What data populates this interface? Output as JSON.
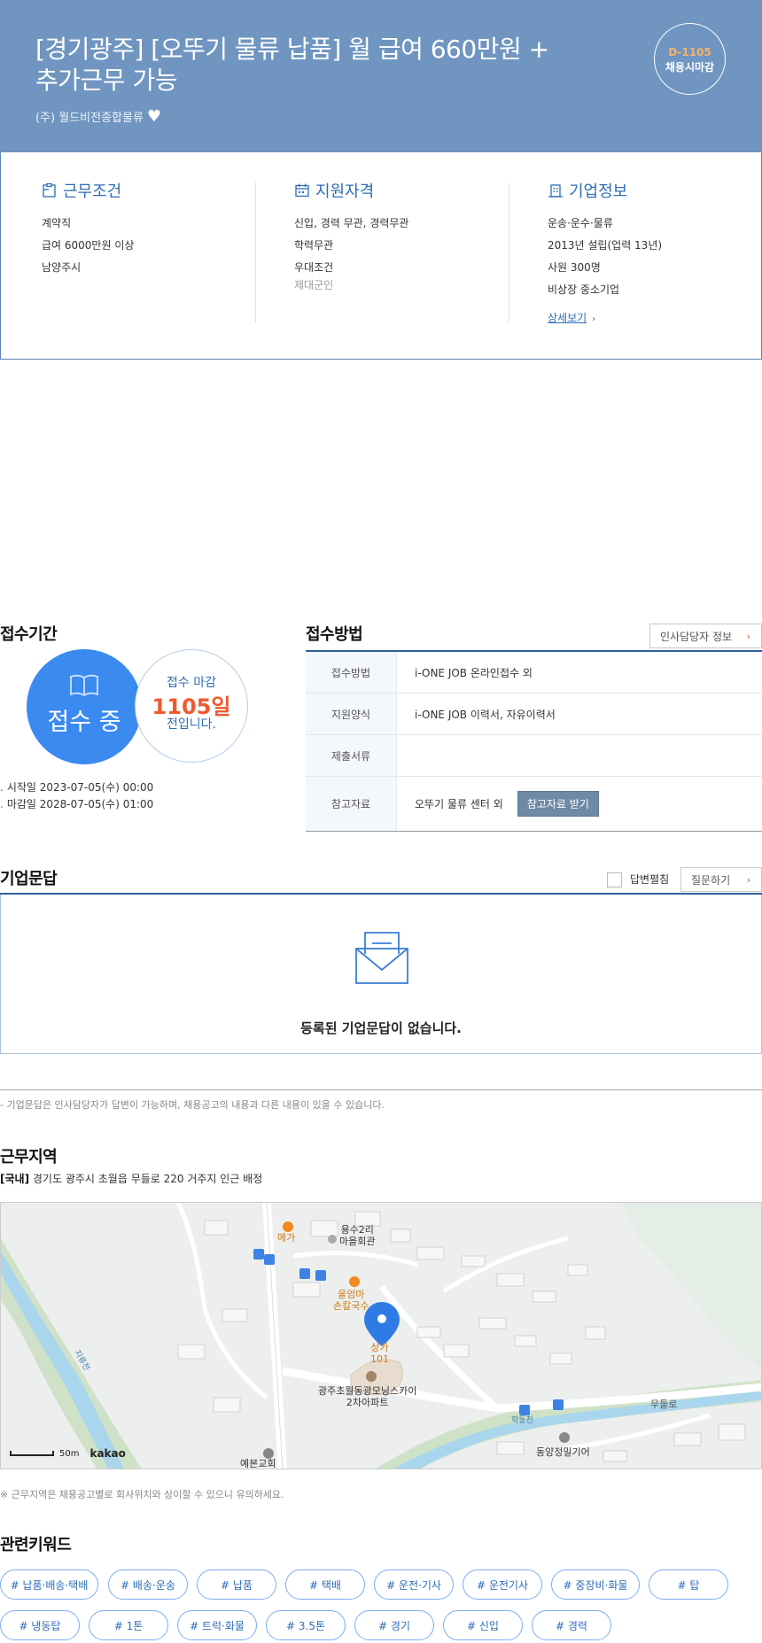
{
  "header": {
    "title_line1": "[경기광주] [오뚜기 물류 납품] 월 급여 660만원 +",
    "title_line2": "추가근무 가능",
    "company": "(주) 월드비전종합물류",
    "dday": "D-1105",
    "deadline_type": "채용시마감"
  },
  "summary": {
    "conditions": {
      "title": "근무조건",
      "items": [
        "계약직",
        "급여 6000만원 이상",
        "남양주시"
      ]
    },
    "qualifications": {
      "title": "지원자격",
      "items": [
        "신입, 경력 무관, 경력무관",
        "학력무관",
        "우대조건"
      ],
      "sub": "제대군인"
    },
    "company_info": {
      "title": "기업정보",
      "items": [
        "운송·운수·물류",
        "2013년 설립(업력 13년)",
        "사원 300명",
        "비상장 중소기업"
      ],
      "detail_link": "상세보기"
    }
  },
  "period": {
    "heading": "접수기간",
    "status": "접수 중",
    "deadline_label": "접수 마감",
    "days": "1105일",
    "days_suffix": "전입니다.",
    "start": "시작일 2023-07-05(수) 00:00",
    "end": "마감일 2028-07-05(수) 01:00"
  },
  "apply": {
    "heading": "접수방법",
    "hr_button": "인사담당자 정보",
    "rows": [
      {
        "label": "접수방법",
        "value": "i-ONE JOB 온라인접수 외"
      },
      {
        "label": "지원양식",
        "value": "i-ONE JOB 이력서, 자유이력서"
      },
      {
        "label": "제출서류",
        "value": ""
      },
      {
        "label": "참고자료",
        "value": "오뚜기 물류 센터 외"
      }
    ],
    "ref_button": "참고자료 받기"
  },
  "qa": {
    "heading": "기업문답",
    "expand_label": "답변펼침",
    "ask_button": "질문하기",
    "empty_text": "등록된 기업문답이 없습니다.",
    "note": "- 기업문답은 인사담당자가 답변이 가능하며, 채용공고의 내용과 다른 내용이 있을 수 있습니다."
  },
  "location": {
    "heading": "근무지역",
    "tag": "[국내]",
    "address": "경기도 광주시 초월읍 무들로 220 거주지 인근 배정",
    "map_labels": {
      "mega": "메가",
      "yongsu_1": "용수2리",
      "yongsu_2": "마을회관",
      "ulum_1": "울엄마",
      "ulum_2": "손칼국수",
      "sanga_1": "상가",
      "sanga_2": "101",
      "apt_1": "광주초월동광모닝스카이",
      "apt_2": "2차아파트",
      "stream_1": "지류천",
      "stream_2": "학동천",
      "road": "무들로",
      "church": "예본교회",
      "factory": "동양정밀기어"
    },
    "scale": "50m",
    "map_logo": "kakao",
    "note": "※ 근무지역은 채용공고별로 회사위치와 상이할 수 있으니 유의하세요."
  },
  "keywords": {
    "heading": "관련키워드",
    "items": [
      "# 납품·배송·택배",
      "# 배송·운송",
      "# 납품",
      "# 택배",
      "# 운전·기사",
      "# 운전기사",
      "# 중장비·화물",
      "# 탑",
      "# 냉동탑",
      "# 1톤",
      "# 트럭·화물",
      "# 3.5톤",
      "# 경기",
      "# 신입",
      "# 경력"
    ]
  },
  "colors": {
    "header_bg": "#7095c0",
    "accent_blue": "#2f6db4",
    "status_blue": "#3a8af0",
    "deadline_orange": "#f0592d"
  }
}
